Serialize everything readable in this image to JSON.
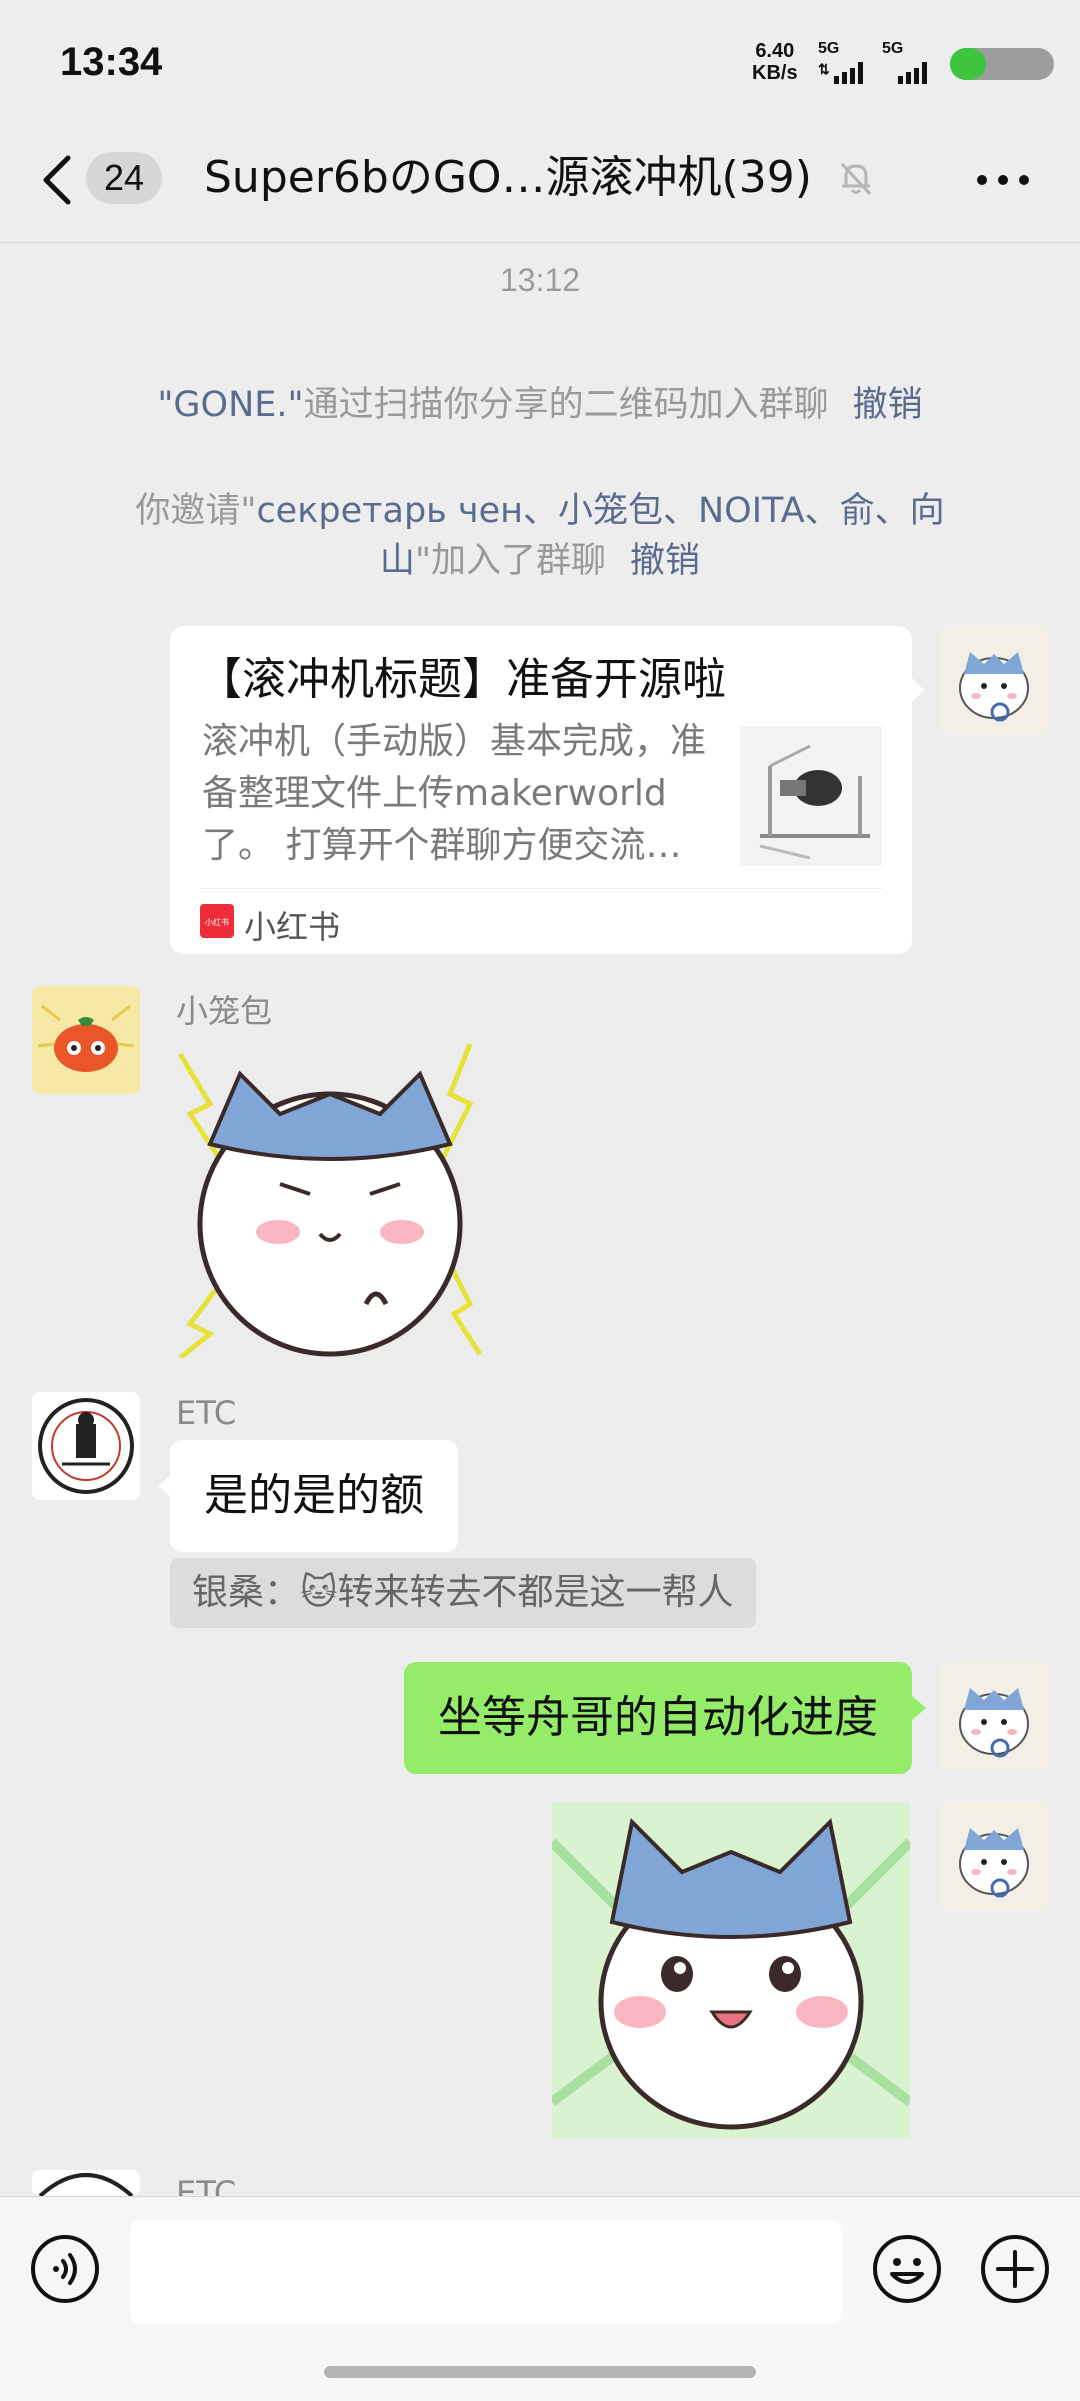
{
  "status_bar": {
    "time": "13:34",
    "net_speed_value": "6.40",
    "net_speed_unit": "KB/s",
    "sim1": "5G",
    "sim2": "5G",
    "battery_level": 0.35
  },
  "header": {
    "back_icon": "chevron-left-icon",
    "unread_count": "24",
    "title": "Super6bのGO…源滚冲机(39)",
    "mute_icon": "bell-off-icon",
    "more_icon": "ellipsis-icon"
  },
  "messages": {
    "timestamp": "13:12",
    "system1": {
      "name": "\"GONE.\"",
      "text": "通过扫描你分享的二维码加入群聊",
      "action": "撤销"
    },
    "system2": {
      "prefix": "你邀请\"",
      "names_line1": "секретарь чен、小笼包、NOITA、俞、向",
      "names_line2": "山",
      "suffix": "\"加入了群聊",
      "action": "撤销"
    },
    "link_card": {
      "title": "【滚冲机标题】准备开源啦",
      "description": "滚冲机（手动版）基本完成，准备整理文件上传makerworld了。 打算开个群聊方便交流…",
      "source": "小红书",
      "source_icon_text": "小红书"
    },
    "msg_xiaolongbao": {
      "sender": "小笼包"
    },
    "msg_etc": {
      "sender": "ETC",
      "text": "是的是的额",
      "quote": "银桑：🐱转来转去不都是这一帮人"
    },
    "msg_me": {
      "text": "坐等舟哥的自动化进度"
    },
    "msg_etc2": {
      "sender": "ETC"
    }
  },
  "colors": {
    "background": "#ededed",
    "my_bubble": "#95ec69",
    "link_text": "#5a6c8e",
    "battery_fill": "#3ec43e"
  }
}
